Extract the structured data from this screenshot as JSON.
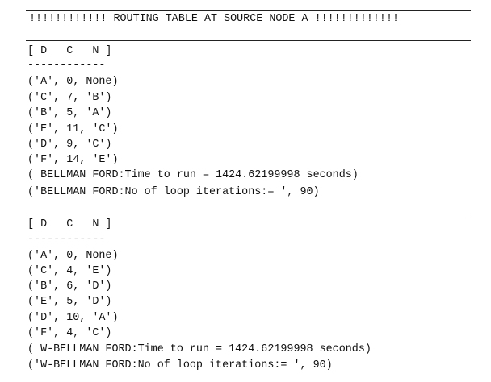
{
  "title": "!!!!!!!!!!!! ROUTING TABLE AT SOURCE NODE A !!!!!!!!!!!!!",
  "tables": [
    {
      "header": "[ D   C   N ]",
      "separator": "------------",
      "rows": [
        "('A', 0, None)",
        "('C', 7, 'B')",
        "('B', 5, 'A')",
        "('E', 11, 'C')",
        "('D', 9, 'C')",
        "('F', 14, 'E')"
      ],
      "runtime": "( BELLMAN FORD:Time to run = 1424.62199998 seconds)",
      "iterations": "('BELLMAN FORD:No of loop iterations:= ', 90)"
    },
    {
      "header": "[ D   C   N ]",
      "separator": "------------",
      "rows": [
        "('A', 0, None)",
        "('C', 4, 'E')",
        "('B', 6, 'D')",
        "('E', 5, 'D')",
        "('D', 10, 'A')",
        "('F', 4, 'C')"
      ],
      "runtime": "( W-BELLMAN FORD:Time to run = 1424.62199998 seconds)",
      "iterations": "('W-BELLMAN FORD:No of loop iterations:= ', 90)"
    }
  ]
}
